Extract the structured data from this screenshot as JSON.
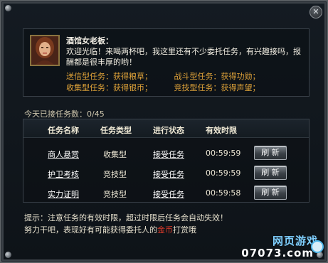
{
  "window": {
    "close_label": "✕"
  },
  "npc": {
    "name": "酒馆女老板：",
    "dialog": "欢迎光临！来喝两杯吧，我这里还有不少委托任务，有兴趣接吗，报酬都是很丰厚的哟！",
    "task_types": [
      [
        {
          "label": "送信型任务：获得粮草；"
        },
        {
          "label": "战斗型任务：获得功勋；"
        }
      ],
      [
        {
          "label": "收集型任务：获得银币；"
        },
        {
          "label": "竞技型任务：获得声望；"
        }
      ]
    ]
  },
  "task_count": {
    "label": "今天已接任务数：",
    "value": "0/45"
  },
  "table": {
    "headers": [
      "任务名称",
      "任务类型",
      "进行状态",
      "有效时限"
    ],
    "rows": [
      {
        "name": "商人悬赏",
        "type": "收集型",
        "status": "接受任务",
        "time": "00:59:59",
        "button": "刷 新"
      },
      {
        "name": "护卫考核",
        "type": "竞技型",
        "status": "接受任务",
        "time": "00:59:59",
        "button": "刷 新"
      },
      {
        "name": "实力证明",
        "type": "竞技型",
        "status": "接受任务",
        "time": "00:59:58",
        "button": "刷 新"
      }
    ]
  },
  "tips": {
    "line1": "提示：注意任务的有效时限，超过时限后任务会自动失效！",
    "line2_before": "努力干吧，表现好有可能获得委托人的",
    "line2_highlight": "金币",
    "line2_after": "打赏哦"
  },
  "watermark": {
    "top": "网页游戏",
    "bottom": "07073.com"
  },
  "colors": {
    "accent_orange": "#e0a339",
    "highlight_red": "#e23b2a",
    "watermark_blue": "#7fd0ff"
  }
}
